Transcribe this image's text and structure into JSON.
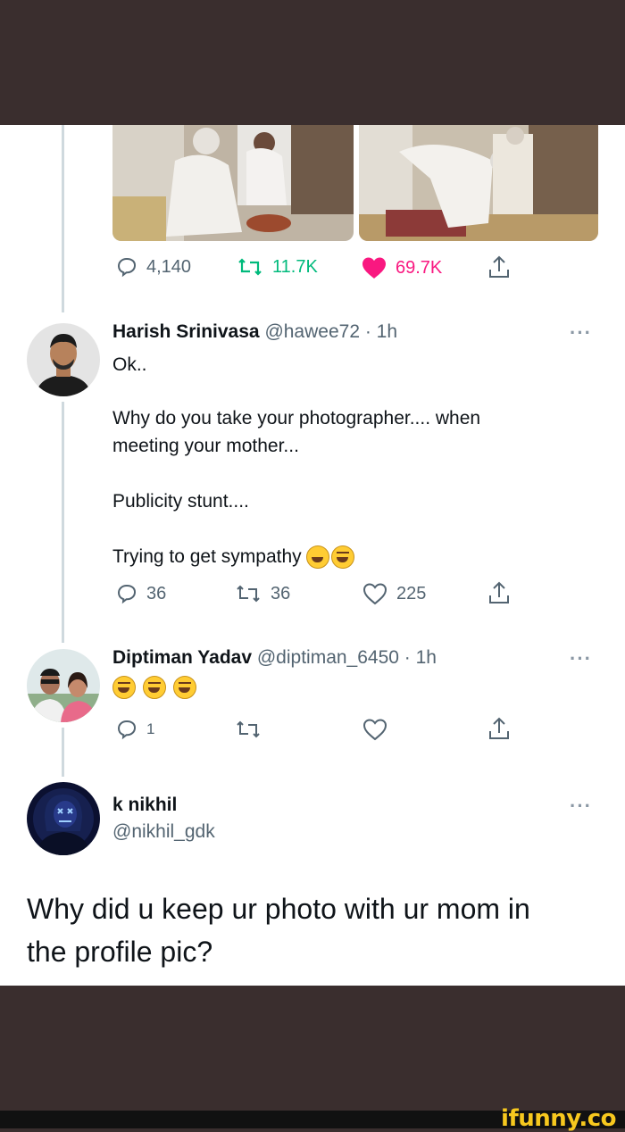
{
  "top_tweet": {
    "stats": {
      "replies": "4,140",
      "retweets": "11.7K",
      "likes": "69.7K"
    }
  },
  "reply1": {
    "name": "Harish Srinivasa",
    "handle": "@hawee72",
    "time": "· 1h",
    "more": "···",
    "lines": [
      "Ok..",
      "Why do you take your photographer.... when",
      "meeting your mother...",
      "Publicity stunt....",
      "Trying to get sympathy"
    ],
    "stats": {
      "replies": "36",
      "retweets": "36",
      "likes": "225"
    }
  },
  "reply2": {
    "name": "Diptiman Yadav",
    "handle": "@diptiman_6450",
    "time": "· 1h",
    "more": "···",
    "stats": {
      "replies": "1"
    }
  },
  "main_tweet": {
    "name": "k nikhil",
    "handle": "@nikhil_gdk",
    "more": "···",
    "text_line1": "Why did u keep ur photo with ur mom in",
    "text_line2": "the profile pic?"
  },
  "watermark": "ifunny.co",
  "colors": {
    "background_dark": "#3a2e2e",
    "retweet_green": "#00ba7c",
    "like_pink": "#f91880",
    "muted_text": "#536471"
  }
}
